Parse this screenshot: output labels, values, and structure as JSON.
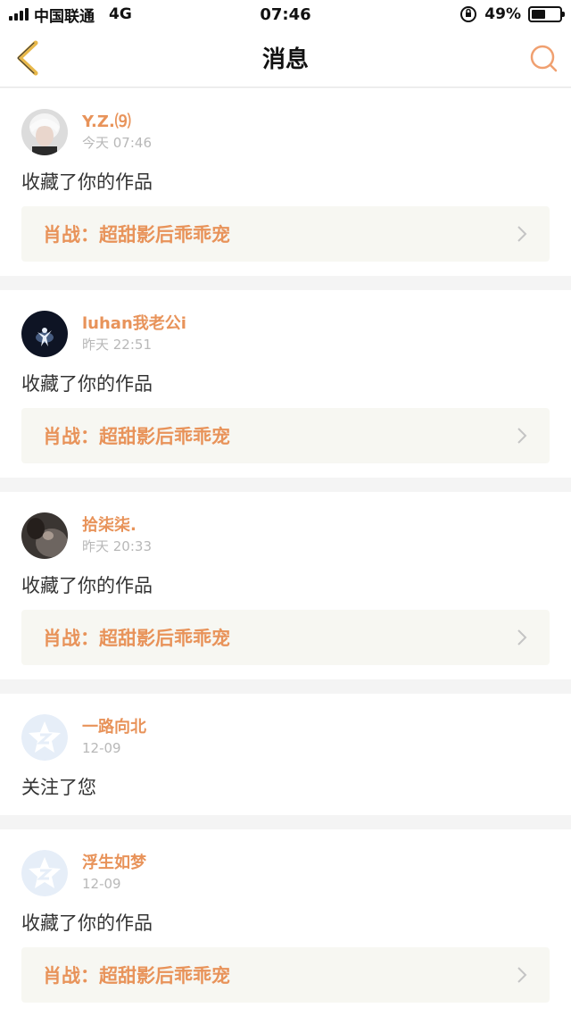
{
  "status_bar": {
    "carrier": "中国联通",
    "network": "4G",
    "time": "07:46",
    "battery": "49%",
    "battery_level": 0.49
  },
  "nav": {
    "title": "消息"
  },
  "notifications": [
    {
      "username": "Y.Z.⑼",
      "time": "今天 07:46",
      "action": "收藏了你的作品",
      "work_title": "肖战：超甜影后乖乖宠",
      "avatar": "white-hair-portrait"
    },
    {
      "username": "luhan我老公i",
      "time": "昨天 22:51",
      "action": "收藏了你的作品",
      "work_title": "肖战：超甜影后乖乖宠",
      "avatar": "stage-silhouette"
    },
    {
      "username": "拾柒柒.",
      "time": "昨天 20:33",
      "action": "收藏了你的作品",
      "work_title": "肖战：超甜影后乖乖宠",
      "avatar": "dark-photo"
    },
    {
      "username": "一路向北",
      "time": "12-09",
      "action": "关注了您",
      "avatar": "default-avatar-icon"
    },
    {
      "username": "浮生如梦",
      "time": "12-09",
      "action": "收藏了你的作品",
      "work_title": "肖战：超甜影后乖乖宠",
      "avatar": "default-avatar-icon"
    }
  ],
  "colors": {
    "accent": "#e8935a",
    "back_icon": "#e8b84a",
    "card_link_bg": "#f7f7f2"
  }
}
